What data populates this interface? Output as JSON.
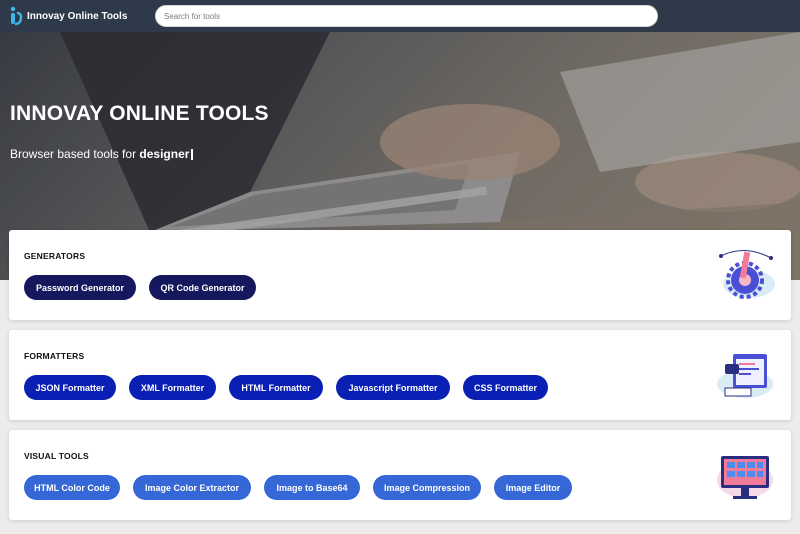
{
  "nav": {
    "logo_text": "Innovay Online Tools",
    "search_placeholder": "Search for tools"
  },
  "hero": {
    "title": "INNOVAY ONLINE TOOLS",
    "subtitle_prefix": "Browser based tools for ",
    "subtitle_word": "designer"
  },
  "sections": [
    {
      "title": "GENERATORS",
      "illustration": "gear-pencil-icon",
      "tools": [
        "Password Generator",
        "QR Code Generator"
      ]
    },
    {
      "title": "FORMATTERS",
      "illustration": "code-formatter-icon",
      "tools": [
        "JSON Formatter",
        "XML Formatter",
        "HTML Formatter",
        "Javascript Formatter",
        "CSS Formatter"
      ]
    },
    {
      "title": "VISUAL TOOLS",
      "illustration": "monitor-grid-icon",
      "tools": [
        "HTML Color Code",
        "Image Color Extractor",
        "Image to Base64",
        "Image Compression",
        "Image Editor"
      ]
    }
  ],
  "colors": {
    "navbar": "#2e3a4a",
    "generators_pill": "#15185c",
    "formatters_pill": "#0a1fb3",
    "visual_pill": "#3567d6"
  }
}
